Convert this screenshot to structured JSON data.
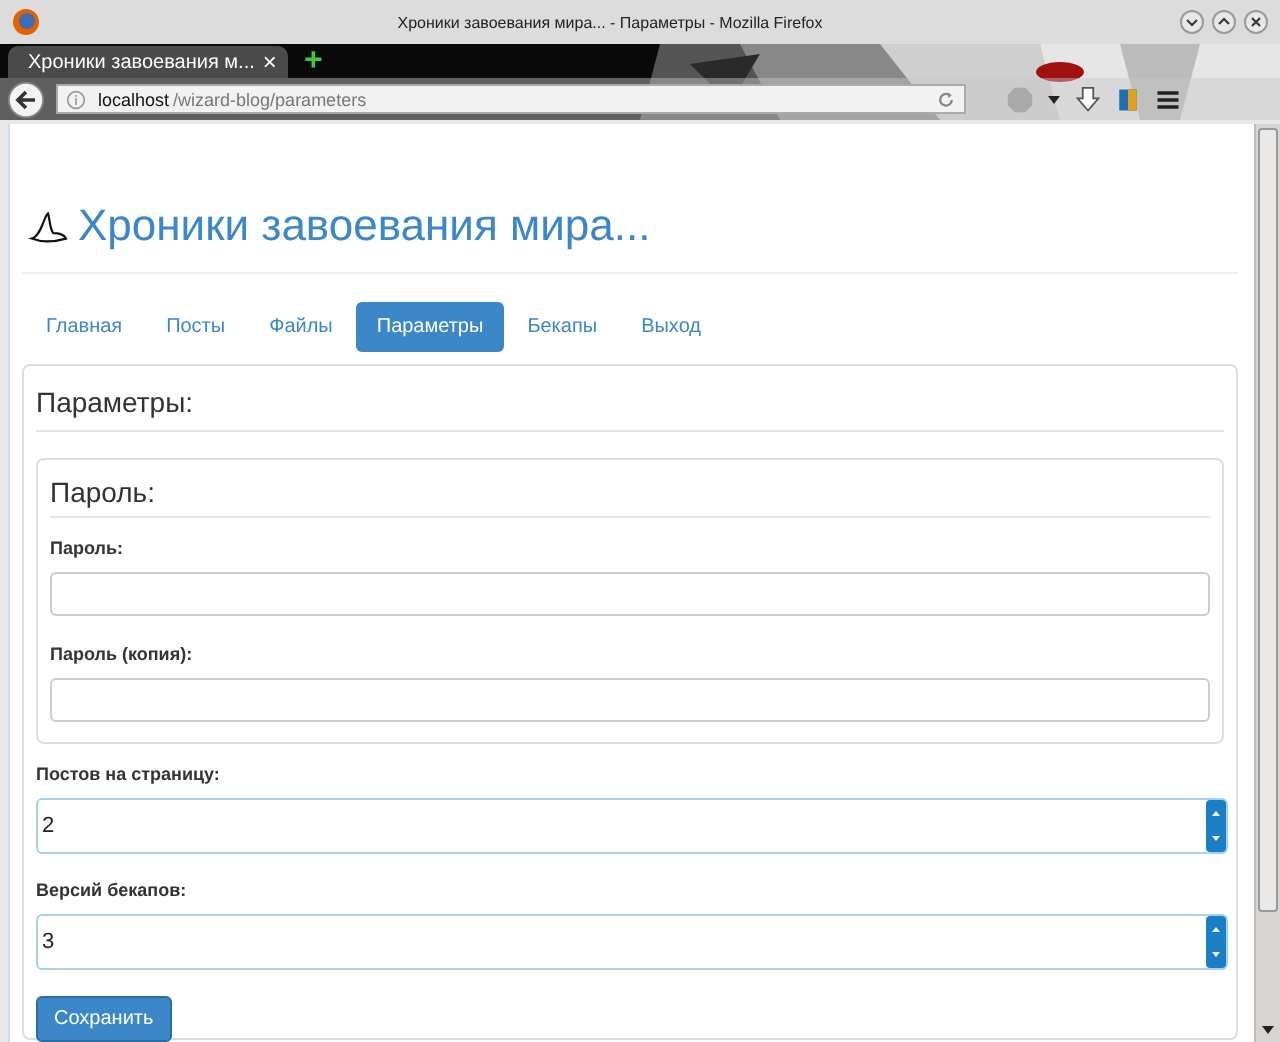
{
  "window": {
    "title": "Хроники завоевания мира... - Параметры - Mozilla Firefox"
  },
  "browser_tab": {
    "title": "Хроники завоевания м...",
    "close": "×",
    "new_tab": "+"
  },
  "address_bar": {
    "host": "localhost",
    "path": "/wizard-blog/parameters"
  },
  "site": {
    "title": "Хроники завоевания мира..."
  },
  "nav": [
    {
      "label": "Главная",
      "selected": false
    },
    {
      "label": "Посты",
      "selected": false
    },
    {
      "label": "Файлы",
      "selected": false
    },
    {
      "label": "Параметры",
      "selected": true
    },
    {
      "label": "Бекапы",
      "selected": false
    },
    {
      "label": "Выход",
      "selected": false
    }
  ],
  "panel": {
    "title": "Параметры:",
    "password_group": {
      "title": "Пароль:",
      "fields": [
        {
          "label": "Пароль:"
        },
        {
          "label": "Пароль (копия):"
        }
      ]
    },
    "number_fields": [
      {
        "label": "Постов на страницу:",
        "value": "2"
      },
      {
        "label": "Версий бекапов:",
        "value": "3"
      }
    ],
    "save_button": "Сохранить"
  }
}
